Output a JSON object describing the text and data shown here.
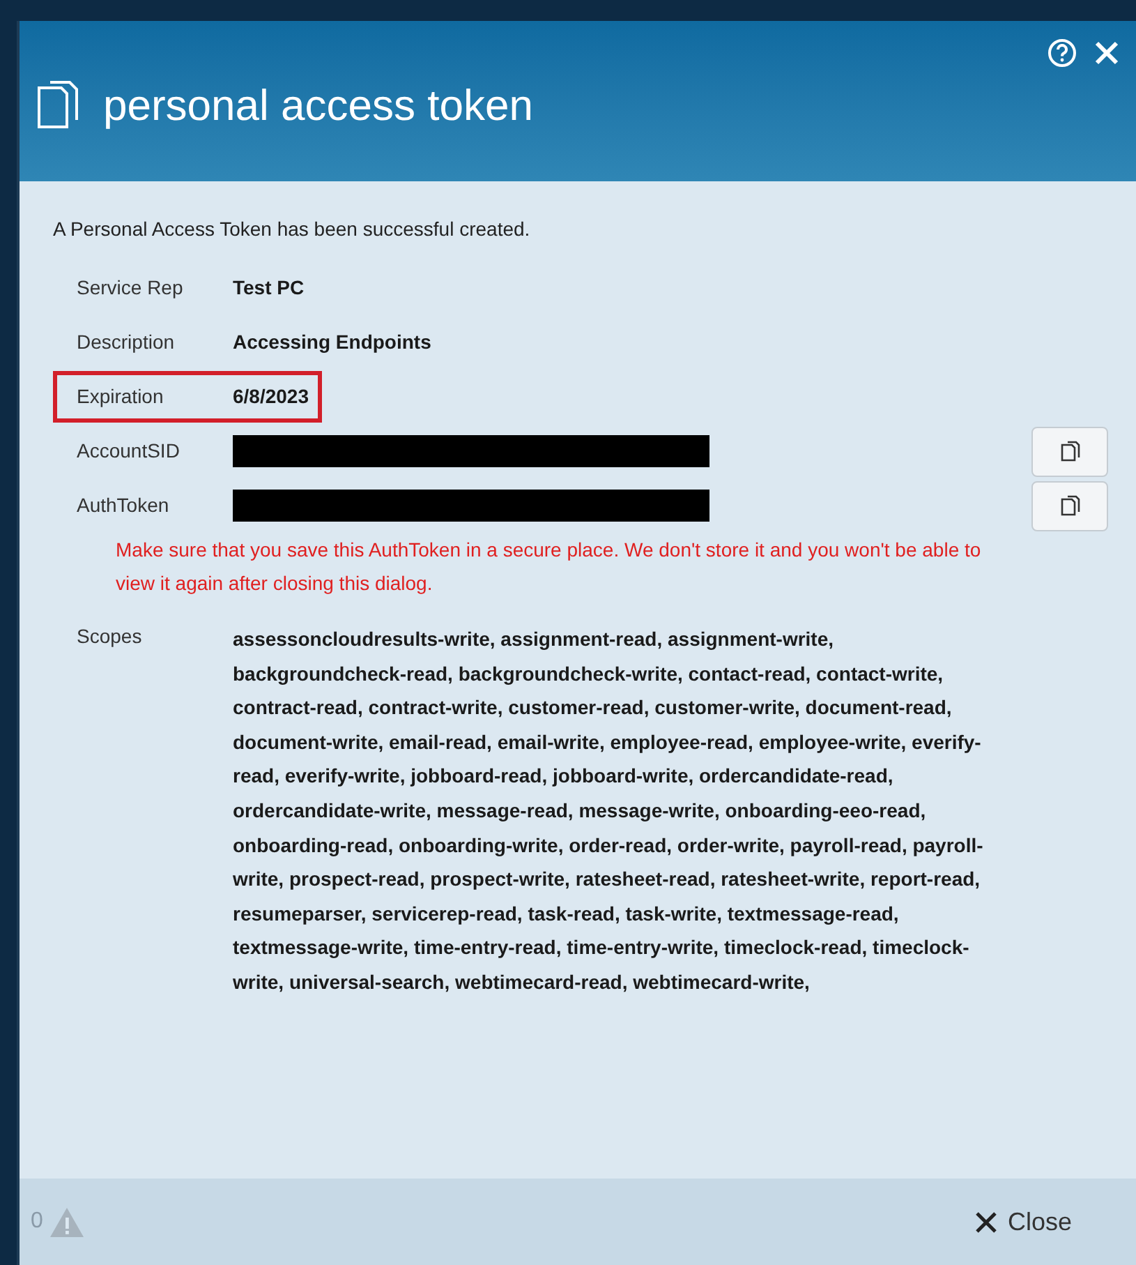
{
  "dialog": {
    "title": "personal access token"
  },
  "message": "A Personal Access Token has been successful created.",
  "fields": [
    {
      "label": "Service Rep",
      "value": "Test PC",
      "kind": "text",
      "highlighted": false
    },
    {
      "label": "Description",
      "value": "Accessing Endpoints",
      "kind": "text",
      "highlighted": false
    },
    {
      "label": "Expiration",
      "value": "6/8/2023",
      "kind": "text",
      "highlighted": true
    },
    {
      "label": "AccountSID",
      "kind": "redacted",
      "highlighted": false
    },
    {
      "label": "AuthToken",
      "kind": "redacted",
      "highlighted": false
    }
  ],
  "warning": "Make sure that you save this AuthToken in a secure place. We don't store it and you won't be able to view it again after closing this dialog.",
  "scopes": {
    "label": "Scopes",
    "value": "assessoncloudresults-write, assignment-read, assignment-write, backgroundcheck-read, backgroundcheck-write, contact-read, contact-write, contract-read, contract-write, customer-read, customer-write, document-read, document-write, email-read, email-write, employee-read, employee-write, everify-read, everify-write, jobboard-read, jobboard-write, ordercandidate-read, ordercandidate-write, message-read, message-write, onboarding-eeo-read, onboarding-read, onboarding-write, order-read, order-write, payroll-read, payroll-write, prospect-read, prospect-write, ratesheet-read, ratesheet-write, report-read, resumeparser, servicerep-read, task-read, task-write, textmessage-read, textmessage-write, time-entry-read, time-entry-write, timeclock-read, timeclock-write, universal-search, webtimecard-read, webtimecard-write,"
  },
  "footer": {
    "alert_count": "0",
    "close_label": "Close"
  }
}
